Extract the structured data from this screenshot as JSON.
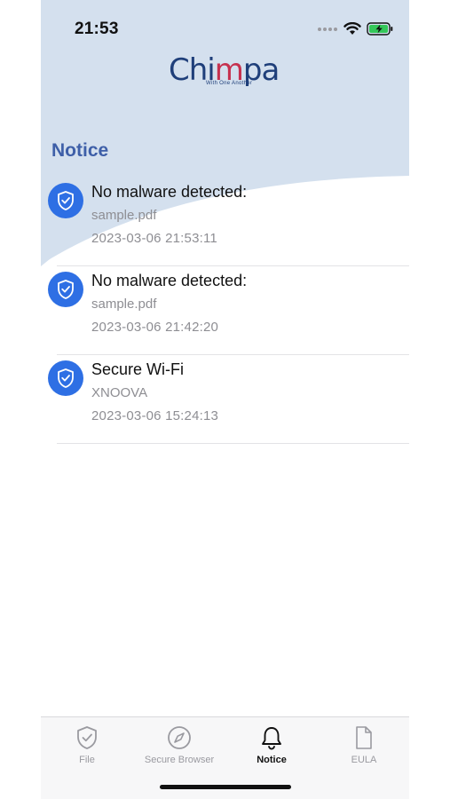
{
  "status_bar": {
    "time": "21:53",
    "signal_icon": "signal-dots-icon",
    "wifi_icon": "wifi-icon",
    "battery_icon": "battery-charging-icon"
  },
  "header": {
    "logo_text_part1": "Chi",
    "logo_text_accent": "m",
    "logo_text_part2": "pa",
    "logo_tagline": "With One Another",
    "title": "Notice"
  },
  "notices": [
    {
      "icon": "shield-check-icon",
      "title": "No malware detected:",
      "subtitle": "sample.pdf",
      "date": "2023-03-06 21:53:11"
    },
    {
      "icon": "shield-check-icon",
      "title": "No malware detected:",
      "subtitle": "sample.pdf",
      "date": "2023-03-06 21:42:20"
    },
    {
      "icon": "shield-check-icon",
      "title": "Secure Wi-Fi",
      "subtitle": "XNOOVA",
      "date": "2023-03-06 15:24:13"
    }
  ],
  "tab_bar": {
    "tabs": [
      {
        "label": "File",
        "icon": "shield-check-outline-icon",
        "active": false
      },
      {
        "label": "Secure Browser",
        "icon": "compass-icon",
        "active": false
      },
      {
        "label": "Notice",
        "icon": "bell-icon",
        "active": true
      },
      {
        "label": "EULA",
        "icon": "document-icon",
        "active": false
      }
    ]
  },
  "colors": {
    "header_bg": "#d4e0ee",
    "title": "#3e5fa8",
    "icon_circle": "#2e6fe4",
    "logo_navy": "#1f3f7a",
    "logo_red": "#c6314f"
  }
}
